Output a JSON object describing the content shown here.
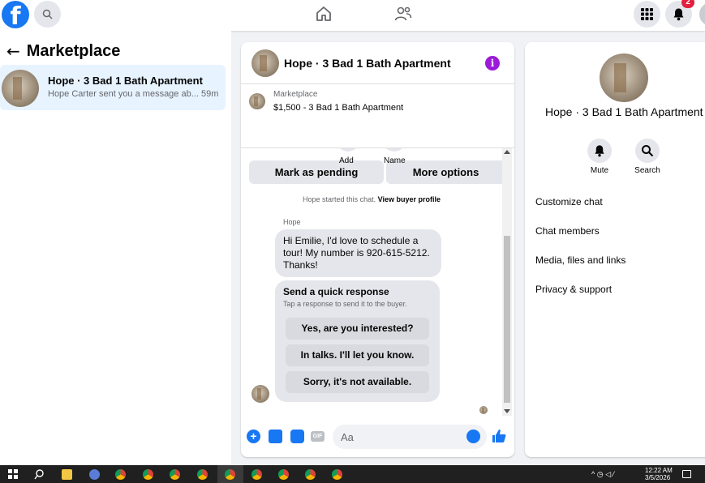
{
  "topbar": {
    "logo_letter": "f",
    "notification_count": "2"
  },
  "sidebar": {
    "back_symbol": "←",
    "title": "Marketplace",
    "conversation": {
      "title": "Hope · 3 Bad 1 Bath Apartment",
      "preview": "Hope Carter sent you a message ab...",
      "time": "59m"
    }
  },
  "chat": {
    "title": "Hope · 3 Bad 1 Bath Apartment",
    "info_symbol": "i",
    "listing": {
      "label": "Marketplace",
      "price_title": "$1,500 - 3 Bad 1 Bath Apartment"
    },
    "buttons": {
      "mark_pending": "Mark as pending",
      "more_options": "More options"
    },
    "top_labels": {
      "add": "Add",
      "name": "Name"
    },
    "started": {
      "text": "Hope started this chat.",
      "link": "View buyer profile"
    },
    "sender_name": "Hope",
    "message": "Hi Emilie, I'd love to schedule a tour! My number is 920-615-5212. Thanks!",
    "quick_response": {
      "title": "Send a quick response",
      "subtitle": "Tap a response to send it to the buyer.",
      "options": [
        "Yes, are you interested?",
        "In talks. I'll let you know.",
        "Sorry, it's not available."
      ]
    },
    "composer": {
      "placeholder": "Aa",
      "plus_symbol": "+",
      "gif_label": "GIF"
    }
  },
  "details": {
    "name": "Hope · 3 Bad 1 Bath Apartment",
    "actions": {
      "mute": "Mute",
      "search": "Search"
    },
    "menu": [
      "Customize chat",
      "Chat members",
      "Media, files and links",
      "Privacy & support"
    ]
  },
  "taskbar": {
    "time": "12:22 AM",
    "date": "3/5/2026"
  },
  "colors": {
    "brand": "#1877f2",
    "info": "#9b1ad8",
    "selected_bg": "#e7f3ff",
    "badge": "#e41e3f"
  },
  "icons": [
    "facebook-logo-icon",
    "search-icon",
    "home-icon",
    "friends-icon",
    "menu-grid-icon",
    "bell-icon",
    "info-icon",
    "plus-icon",
    "photo-icon",
    "sticker-icon",
    "gif-icon",
    "emoji-icon",
    "like-icon",
    "mute-icon",
    "chevron-down-icon",
    "windows-start-icon",
    "chrome-icon"
  ]
}
